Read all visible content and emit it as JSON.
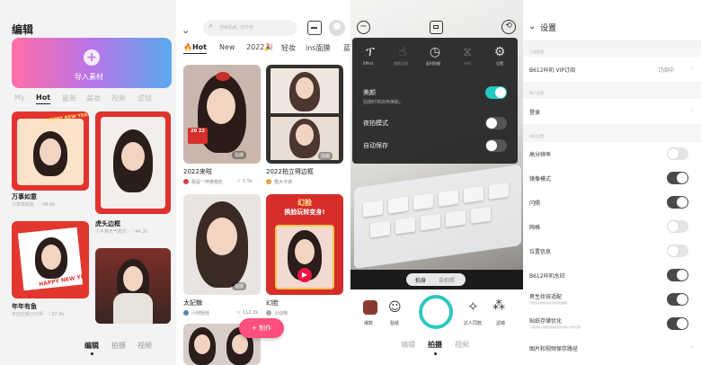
{
  "panel1": {
    "title": "编辑",
    "upload_label": "导入素材",
    "tabs": [
      "My",
      "Hot",
      "最新",
      "美妆",
      "视频",
      "滤镜"
    ],
    "items": [
      {
        "title": "万事如意",
        "meta": "小草莓甜桃 · ♡48.6k"
      },
      {
        "title": "虎头边框",
        "meta": "小平着天气阳光 · ♡44.2k"
      },
      {
        "title": "年年有鱼",
        "meta": "年廷应援沙沙罗 · ♡27.4k"
      }
    ],
    "card_text": [
      "HAPPY NEW YEAR",
      "HAPPY NEW YEAR"
    ],
    "bottom_nav": [
      "编辑",
      "拍摄",
      "视频"
    ]
  },
  "panel2": {
    "search_placeholder": "搜索贴纸, 创作者",
    "tabs": [
      "🔥Hot",
      "New",
      "2022🎉",
      "轻妆",
      "ins面膜",
      "蓝"
    ],
    "items": [
      {
        "title": "2022来啦",
        "user": "我是一杯卷卷奶",
        "likes": "5.5k",
        "badge": "拍摄",
        "stamp": "20 22"
      },
      {
        "title": "2022拍立得边框",
        "user": "橙大卡通",
        "likes": "",
        "badge": "拍摄"
      },
      {
        "title": "太妃糖",
        "user": "小阿轻轻",
        "likes": "112.3k",
        "badge": "拍摄"
      },
      {
        "title": "幻脸",
        "user": "小动物",
        "likes": "",
        "badge": ""
      }
    ],
    "promo_text": "幻脸\n换脸玩转变身!",
    "promo_title": "幻脸",
    "promo_subtitle": "换脸玩转变身!",
    "fab_label": "+ 制作"
  },
  "panel3": {
    "toolbar": [
      "Effect",
      "美颜自拍",
      "延时拍摄",
      "计时",
      "设置"
    ],
    "settings": [
      {
        "label": "美颜",
        "desc": "拍摄时将启用美颜。",
        "on": true
      },
      {
        "label": "夜拍模式",
        "on": false
      },
      {
        "label": "自动保存",
        "on": false
      }
    ],
    "modes": [
      "拍身",
      "自拍照"
    ],
    "left_tools": [
      "爆款",
      "贴纸"
    ],
    "right_tools": [
      "达人同款",
      "滤镜"
    ],
    "bottom_nav": [
      "编辑",
      "拍摄",
      "视频"
    ]
  },
  "panel4": {
    "title": "设置",
    "sections": [
      {
        "header": "订阅管理",
        "rows": [
          {
            "label": "B612咔叽 VIP订阅",
            "value": "订阅中"
          }
        ]
      },
      {
        "header": "账户设置",
        "rows": [
          {
            "label": "登录",
            "value": ""
          }
        ]
      },
      {
        "header": "相机设置",
        "rows": [
          {
            "label": "高分辨率",
            "toggle": false
          },
          {
            "label": "镜像模式",
            "toggle": true
          },
          {
            "label": "闪照",
            "toggle": true
          },
          {
            "label": "网格",
            "toggle": false
          },
          {
            "label": "位置信息",
            "toggle": false
          },
          {
            "label": "B612咔叽水印",
            "toggle": true
          },
          {
            "label": "男生妆容适配",
            "sub": "开启后系统将自动识别男性面部",
            "toggle": true
          },
          {
            "label": "贴纸存储优化",
            "sub": "下载次数少的贴纸将被自动清除以节省空间",
            "toggle": true
          },
          {
            "label": "图片和视频保存路径",
            "value": ""
          }
        ]
      }
    ]
  }
}
